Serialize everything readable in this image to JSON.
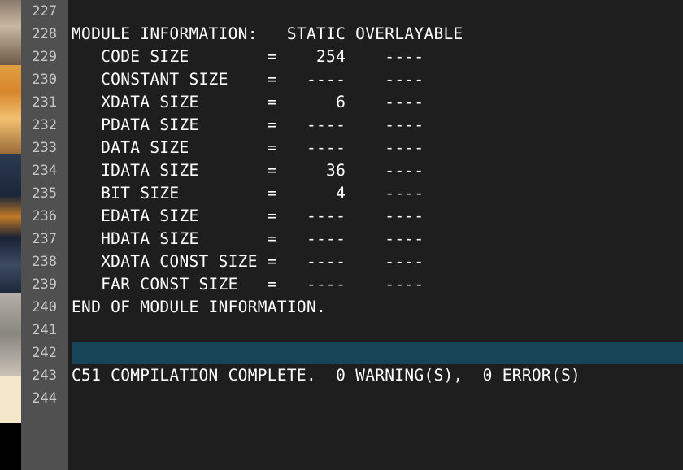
{
  "editor": {
    "lines": [
      {
        "number": "227",
        "text": ""
      },
      {
        "number": "228",
        "text": "MODULE INFORMATION:   STATIC OVERLAYABLE"
      },
      {
        "number": "229",
        "text": "   CODE SIZE        =    254    ----"
      },
      {
        "number": "230",
        "text": "   CONSTANT SIZE    =   ----    ----"
      },
      {
        "number": "231",
        "text": "   XDATA SIZE       =      6    ----"
      },
      {
        "number": "232",
        "text": "   PDATA SIZE       =   ----    ----"
      },
      {
        "number": "233",
        "text": "   DATA SIZE        =   ----    ----"
      },
      {
        "number": "234",
        "text": "   IDATA SIZE       =     36    ----"
      },
      {
        "number": "235",
        "text": "   BIT SIZE         =      4    ----"
      },
      {
        "number": "236",
        "text": "   EDATA SIZE       =   ----    ----"
      },
      {
        "number": "237",
        "text": "   HDATA SIZE       =   ----    ----"
      },
      {
        "number": "238",
        "text": "   XDATA CONST SIZE =   ----    ----"
      },
      {
        "number": "239",
        "text": "   FAR CONST SIZE   =   ----    ----"
      },
      {
        "number": "240",
        "text": "END OF MODULE INFORMATION."
      },
      {
        "number": "241",
        "text": ""
      },
      {
        "number": "242",
        "text": ""
      },
      {
        "number": "243",
        "text": "C51 COMPILATION COMPLETE.  0 WARNING(S),  0 ERROR(S)"
      },
      {
        "number": "244",
        "text": ""
      }
    ],
    "current_line_index": 15
  },
  "colors": {
    "editor_background": "#1e1e1e",
    "gutter_background": "#505050",
    "line_number": "#c8c8c8",
    "text": "#ffffff",
    "current_line_highlight": "#174456"
  }
}
